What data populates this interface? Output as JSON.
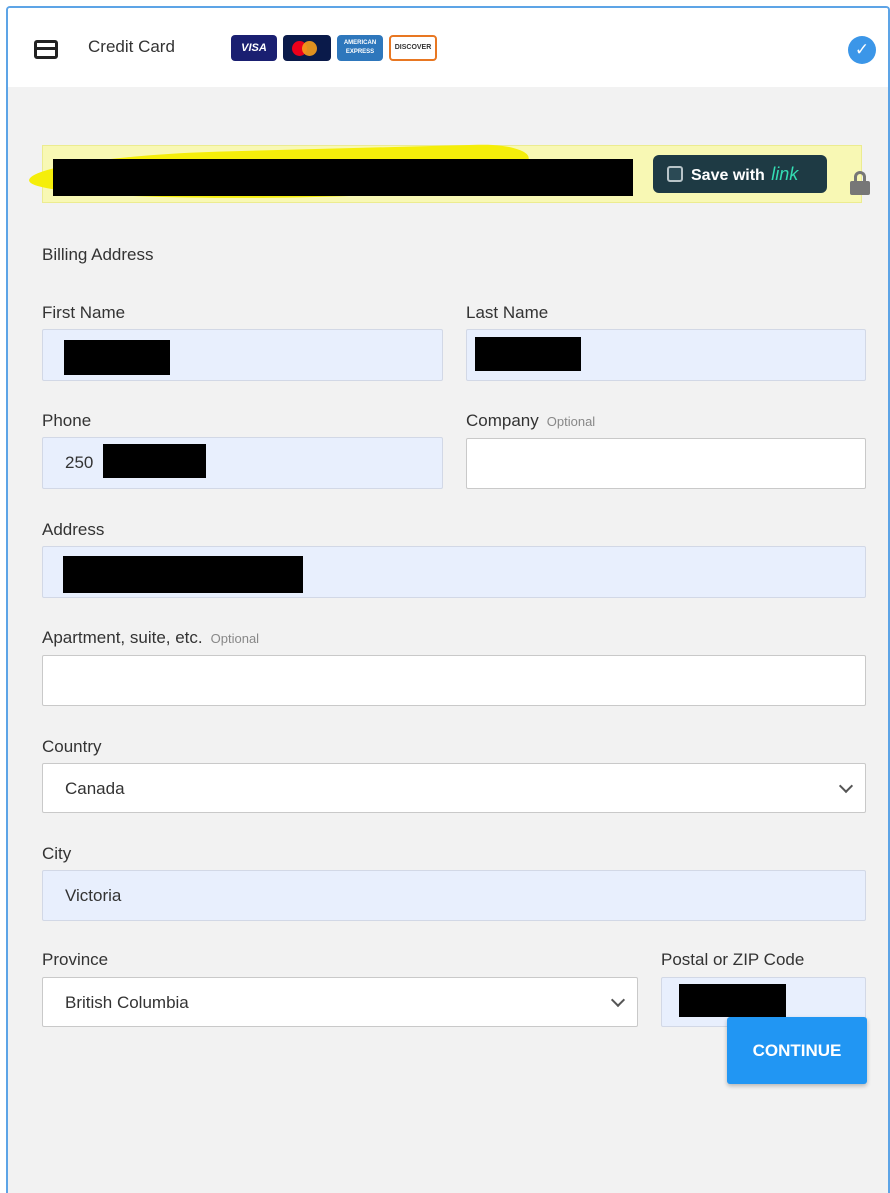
{
  "header": {
    "title": "Credit Card",
    "brands": {
      "visa": "VISA",
      "mastercard": "mastercard",
      "amex": "AMERICAN EXPRESS",
      "discover": "DISCOVER"
    },
    "selected_icon": "check-circle-icon",
    "accent": "#3b96e8"
  },
  "card_row": {
    "save_label": "Save with",
    "save_brand": "link",
    "save_bg": "#1e3a44",
    "save_brand_color": "#33ddb3",
    "lock_icon": "lock-icon"
  },
  "billing": {
    "title": "Billing Address",
    "first_name_label": "First Name",
    "last_name_label": "Last Name",
    "phone_label": "Phone",
    "phone_value_visible": "250",
    "company_label": "Company",
    "company_optional": "Optional",
    "address_label": "Address",
    "apartment_label": "Apartment, suite, etc.",
    "apartment_optional": "Optional",
    "country_label": "Country",
    "country_value": "Canada",
    "city_label": "City",
    "city_value": "Victoria",
    "province_label": "Province",
    "province_value": "British Columbia",
    "postal_label": "Postal or ZIP Code",
    "filled_field_bg": "#e8effd"
  },
  "actions": {
    "continue_label": "CONTINUE",
    "continue_bg": "#2196f3"
  }
}
